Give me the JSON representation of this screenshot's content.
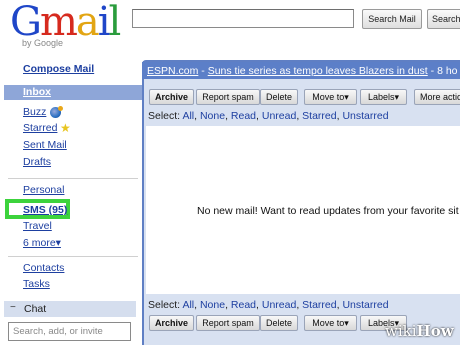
{
  "logo": {
    "word": "Gmail",
    "tagline": "by Google"
  },
  "search": {
    "value": "",
    "search_mail_label": "Search Mail",
    "search_web_label": "Search"
  },
  "sidebar": {
    "compose": "Compose Mail",
    "inbox": "Inbox",
    "items": {
      "buzz": "Buzz",
      "starred": "Starred",
      "sent": "Sent Mail",
      "drafts": "Drafts",
      "personal": "Personal",
      "sms": "SMS (95)",
      "travel": "Travel",
      "more": "6 more▾",
      "contacts": "Contacts",
      "tasks": "Tasks"
    },
    "chat": {
      "label": "Chat",
      "minus": "−",
      "search_placeholder": "Search, add, or invite"
    }
  },
  "ad": {
    "source": "ESPN.com",
    "separator": " - ",
    "headline": "Suns tie series as tempo leaves Blazers in dust",
    "time": " - 8 ho"
  },
  "toolbar": {
    "archive": "Archive",
    "report_spam": "Report spam",
    "delete": "Delete",
    "move_to": "Move to▾",
    "labels": "Labels▾",
    "more_actions": "More actio"
  },
  "select": {
    "prefix": "Select:",
    "options": [
      "All",
      "None",
      "Read",
      "Unread",
      "Starred",
      "Unstarred"
    ]
  },
  "message": "No new mail! Want to read updates from your favorite sit",
  "watermark": {
    "wiki": "wiki",
    "how": "How"
  },
  "colors": {
    "accent": "#5c7fc8",
    "highlight": "#3cd33c",
    "link": "#1d3fa0"
  }
}
